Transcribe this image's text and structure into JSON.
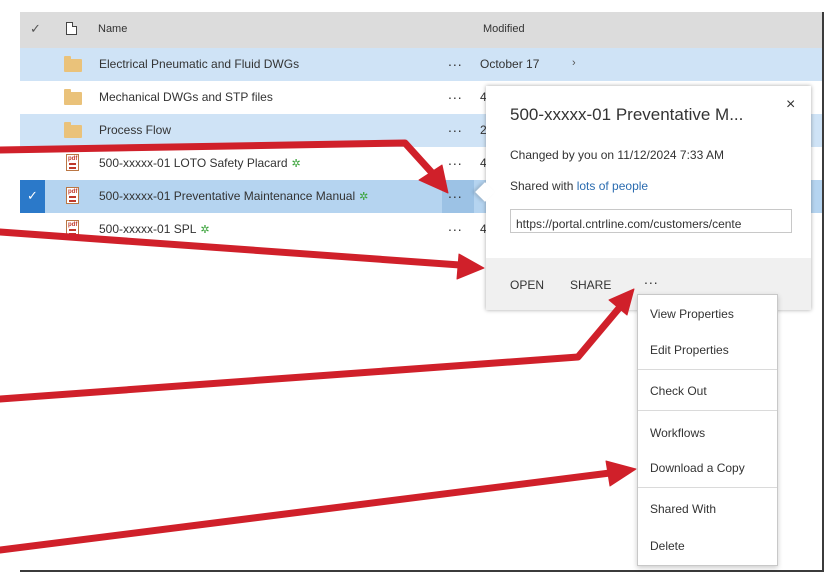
{
  "header": {
    "check_glyph": "✓",
    "name_label": "Name",
    "modified_label": "Modified"
  },
  "rows": [
    {
      "type": "folder",
      "name": "Electrical Pneumatic and Fluid DWGs",
      "more": "...",
      "modified": "October 17",
      "chevron": "›",
      "state": "highlighted"
    },
    {
      "type": "folder",
      "name": "Mechanical DWGs and STP files",
      "more": "...",
      "modified": "4",
      "state": "normal"
    },
    {
      "type": "folder",
      "name": "Process Flow",
      "more": "...",
      "modified": "2",
      "state": "highlighted"
    },
    {
      "type": "pdf",
      "name": "500-xxxxx-01 LOTO Safety Placard",
      "badge": "✲",
      "more": "...",
      "modified": "4",
      "state": "normal"
    },
    {
      "type": "pdf",
      "name": "500-xxxxx-01 Preventative Maintenance Manual",
      "badge": "✲",
      "more": "...",
      "modified": "",
      "state": "selected"
    },
    {
      "type": "pdf",
      "name": "500-xxxxx-01 SPL",
      "badge": "✲",
      "more": "...",
      "modified": "4",
      "state": "normal"
    }
  ],
  "pdf_icon_text": "pdf",
  "callout": {
    "title": "500-xxxxx-01 Preventative M...",
    "close": "×",
    "changed": "Changed by you on 11/12/2024 7:33 AM",
    "shared_prefix": "Shared with ",
    "shared_link": "lots of people",
    "url": "https://portal.cntrline.com/customers/cente",
    "open_label": "OPEN",
    "share_label": "SHARE",
    "more_label": "..."
  },
  "menu": {
    "items": [
      "View Properties",
      "Edit Properties",
      "Check Out",
      "Workflows",
      "Download a Copy",
      "Shared With",
      "Delete"
    ]
  },
  "colors": {
    "arrow": "#d0202a",
    "selected_checkbox": "#2b79c9",
    "row_highlight": "#cfe3f6",
    "link": "#2b6cb0"
  }
}
